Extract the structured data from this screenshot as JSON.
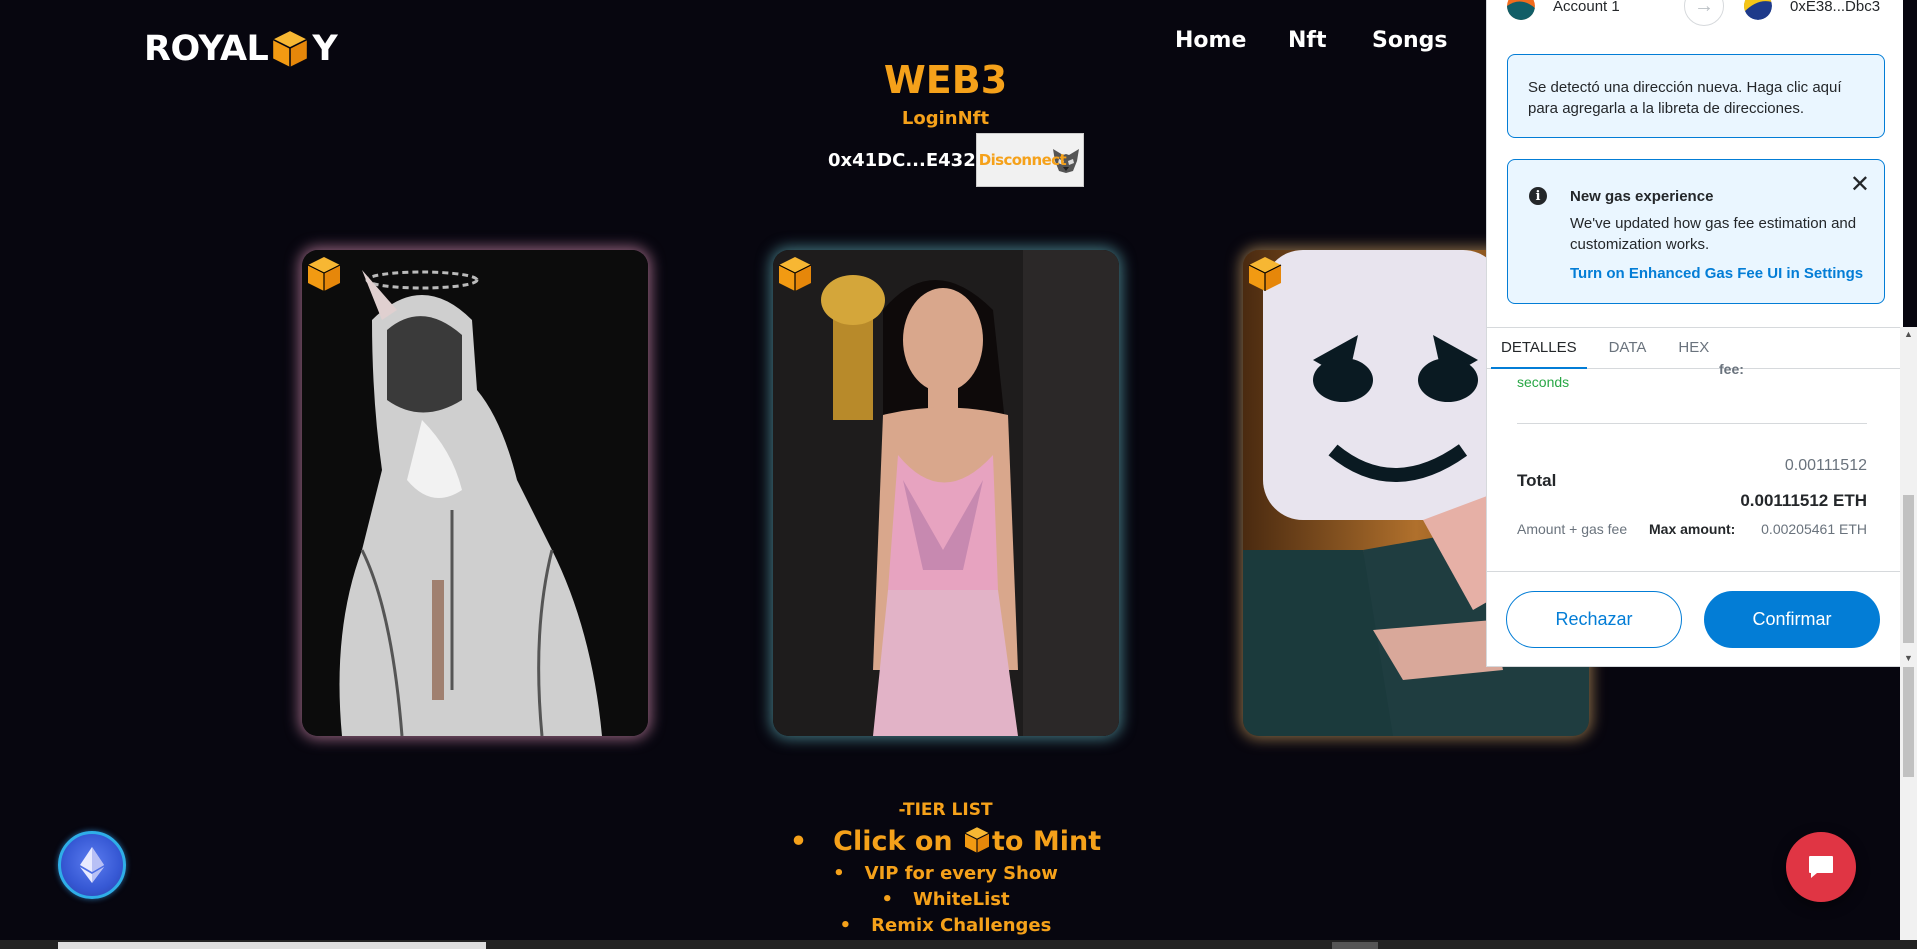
{
  "header": {
    "logo_left": "ROYAL",
    "logo_right": "Y",
    "nav": [
      {
        "label": "Home"
      },
      {
        "label": "Nft"
      },
      {
        "label": "Songs"
      }
    ]
  },
  "hero": {
    "title": "WEB3",
    "subtitle": "LoginNft",
    "wallet_address": "0x41DC...E432",
    "disconnect_label": "Disconnect"
  },
  "tier": {
    "title": "-TIER LIST",
    "items": [
      {
        "before": "Click on",
        "after": "to Mint"
      },
      {
        "label": "VIP for every Show"
      },
      {
        "label": "WhiteList"
      },
      {
        "label": "Remix Challenges"
      }
    ]
  },
  "metamask": {
    "from_account": "Account 1",
    "to_account": "0xE38...Dbc3",
    "notice": "Se detectó una dirección nueva. Haga clic aquí para agregarla a la libreta de direcciones.",
    "gas_title": "New gas experience",
    "gas_body": "We've updated how gas fee estimation and customization works.",
    "gas_link": "Turn on Enhanced Gas Fee UI in Settings",
    "tabs": [
      {
        "label": "DETALLES"
      },
      {
        "label": "DATA"
      },
      {
        "label": "HEX"
      }
    ],
    "seconds": "seconds",
    "fee_label": "fee:",
    "total_label": "Total",
    "total_eth_small": "0.00111512",
    "total_eth": "0.00111512 ETH",
    "amount_gas": "Amount + gas fee",
    "max_label": "Max amount:",
    "max_value": "0.00205461 ETH",
    "reject_label": "Rechazar",
    "confirm_label": "Confirmar"
  },
  "colors": {
    "accent_orange": "#f5a11a",
    "background": "#07060f",
    "metamask_blue": "#037dd6",
    "chat_red": "#e03544"
  }
}
